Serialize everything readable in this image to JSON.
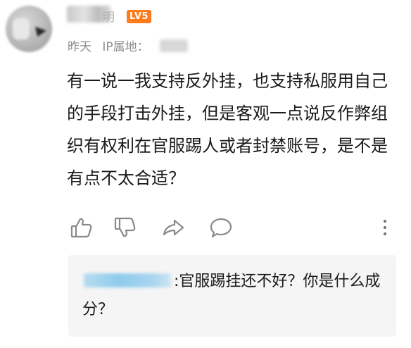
{
  "comment": {
    "username_visible_tail": "明",
    "level_badge": "LV5",
    "time": "昨天",
    "ip_label": "IP属地：",
    "text": "有一说一我支持反外挂，也支持私服用自己的手段打击外挂，但是客观一点说反作弊组织有权利在官服踢人或者封禁账号，是不是有点不太合适？"
  },
  "actions": {
    "items": [
      {
        "name": "like",
        "icon": "thumbs-up-icon"
      },
      {
        "name": "dislike",
        "icon": "thumbs-down-icon"
      },
      {
        "name": "share",
        "icon": "share-icon"
      },
      {
        "name": "reply",
        "icon": "comment-icon"
      },
      {
        "name": "more",
        "icon": "more-vertical-icon"
      }
    ]
  },
  "reply": {
    "separator": ":",
    "text": "官服踢挂还不好？你是什么成分？"
  },
  "colors": {
    "level_badge": "#ff7a1a",
    "meta_text": "#8c8c8c",
    "icon": "#8a8a8a",
    "reply_bg": "#f5f5f5"
  }
}
